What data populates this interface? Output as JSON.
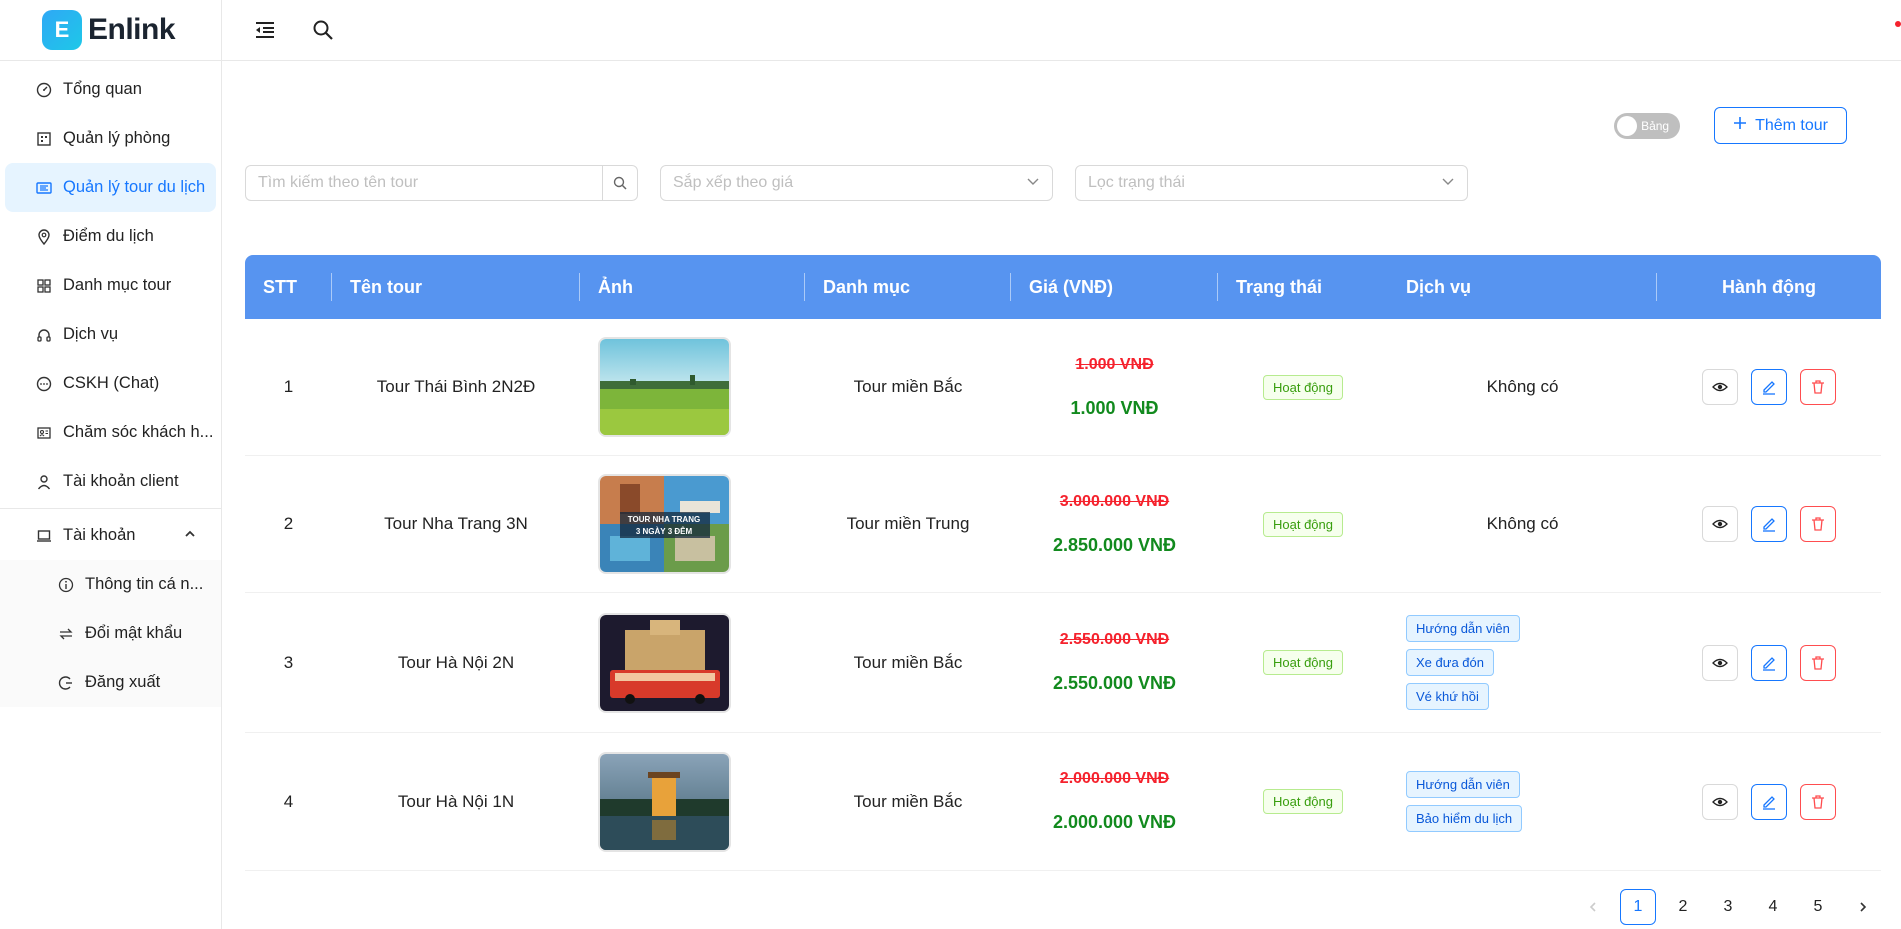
{
  "brand": {
    "logo_letter": "E",
    "name": "Enlink"
  },
  "sidebar": {
    "items": [
      {
        "label": "Tổng quan",
        "icon": "dashboard-icon"
      },
      {
        "label": "Quản lý phòng",
        "icon": "room-icon"
      },
      {
        "label": "Quản lý tour du lịch",
        "icon": "tour-list-icon",
        "active": true
      },
      {
        "label": "Điểm du lịch",
        "icon": "location-icon"
      },
      {
        "label": "Danh mục tour",
        "icon": "category-icon"
      },
      {
        "label": "Dịch vụ",
        "icon": "headphones-icon"
      },
      {
        "label": "CSKH (Chat)",
        "icon": "chat-icon"
      },
      {
        "label": "Chăm sóc khách h...",
        "icon": "customer-care-icon"
      },
      {
        "label": "Tài khoản client",
        "icon": "user-icon"
      }
    ],
    "account": {
      "label": "Tài khoản",
      "sub": [
        {
          "label": "Thông tin cá n...",
          "icon": "info-icon"
        },
        {
          "label": "Đổi mật khẩu",
          "icon": "swap-icon"
        },
        {
          "label": "Đăng xuất",
          "icon": "logout-icon"
        }
      ]
    }
  },
  "toolbar": {
    "view_toggle_label": "Bảng",
    "add_button_label": "Thêm tour"
  },
  "filters": {
    "search_placeholder": "Tìm kiếm theo tên tour",
    "sort_placeholder": "Sắp xếp theo giá",
    "status_placeholder": "Lọc trạng thái"
  },
  "table": {
    "headers": [
      "STT",
      "Tên tour",
      "Ảnh",
      "Danh mục",
      "Giá (VNĐ)",
      "Trạng thái",
      "Dịch vụ",
      "Hành động"
    ],
    "rows": [
      {
        "stt": "1",
        "name": "Tour Thái Bình 2N2Đ",
        "category": "Tour miền Bắc",
        "old_price": "1.000 VNĐ",
        "new_price": "1.000 VNĐ",
        "status": "Hoạt động",
        "services": [],
        "no_service": "Không có"
      },
      {
        "stt": "2",
        "name": "Tour Nha Trang 3N",
        "category": "Tour miền Trung",
        "old_price": "3.000.000 VNĐ",
        "new_price": "2.850.000 VNĐ",
        "status": "Hoạt động",
        "services": [],
        "no_service": "Không có",
        "img_caption_1": "TOUR NHA TRANG",
        "img_caption_2": "3 NGÀY 3 ĐÊM"
      },
      {
        "stt": "3",
        "name": "Tour Hà Nội 2N",
        "category": "Tour miền Bắc",
        "old_price": "2.550.000 VNĐ",
        "new_price": "2.550.000 VNĐ",
        "status": "Hoạt động",
        "services": [
          "Hướng dẫn viên",
          "Xe đưa đón",
          "Vé khứ hồi"
        ]
      },
      {
        "stt": "4",
        "name": "Tour Hà Nội 1N",
        "category": "Tour miền Bắc",
        "old_price": "2.000.000 VNĐ",
        "new_price": "2.000.000 VNĐ",
        "status": "Hoạt động",
        "services": [
          "Hướng dẫn viên",
          "Bảo hiểm du lịch"
        ]
      }
    ]
  },
  "pagination": {
    "pages": [
      "1",
      "2",
      "3",
      "4",
      "5"
    ],
    "current": "1"
  },
  "colors": {
    "primary": "#1677ff",
    "table_header": "#5794f0",
    "price_old": "#f5222d",
    "price_new": "#128a1e"
  }
}
